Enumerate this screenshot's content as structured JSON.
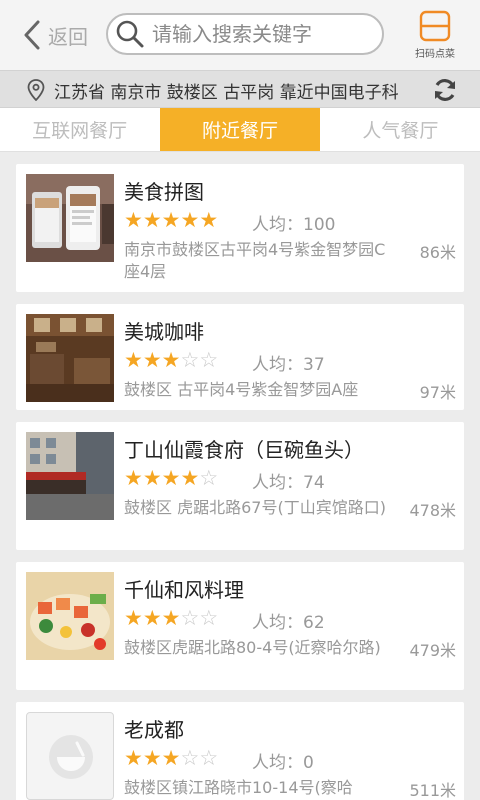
{
  "header": {
    "back_label": "返回",
    "search_placeholder": "请输入搜索关键字",
    "scan_label": "扫码点菜"
  },
  "location": {
    "text": "江苏省 南京市 鼓楼区 古平岗 靠近中国电子科"
  },
  "tabs": [
    {
      "label": "互联网餐厅",
      "active": false
    },
    {
      "label": "附近餐厅",
      "active": true
    },
    {
      "label": "人气餐厅",
      "active": false
    }
  ],
  "restaurants": [
    {
      "name": "美食拼图",
      "rating": 5,
      "avg_label": "人均：100",
      "address": "南京市鼓楼区古平岗4号紫金智梦园C座4层",
      "distance": "86米"
    },
    {
      "name": "美城咖啡",
      "rating": 3,
      "avg_label": "人均：37",
      "address": "鼓楼区 古平岗4号紫金智梦园A座",
      "distance": "97米"
    },
    {
      "name": "丁山仙霞食府（巨碗鱼头）",
      "rating": 4,
      "avg_label": "人均：74",
      "address": "鼓楼区 虎踞北路67号(丁山宾馆路口)",
      "distance": "478米"
    },
    {
      "name": "千仙和风料理",
      "rating": 3,
      "avg_label": "人均：62",
      "address": "鼓楼区虎踞北路80-4号(近察哈尔路)",
      "distance": "479米"
    },
    {
      "name": "老成都",
      "rating": 3,
      "avg_label": "人均：0",
      "address": "鼓楼区镇江路晓市10-14号(察哈",
      "distance": "511米"
    }
  ],
  "colors": {
    "accent": "#f5b027",
    "star_on": "#f5a623",
    "star_off": "#c9c9c9"
  },
  "icons": [
    "chevron-left-icon",
    "search-icon",
    "scan-menu-icon",
    "location-pin-icon",
    "refresh-icon"
  ]
}
